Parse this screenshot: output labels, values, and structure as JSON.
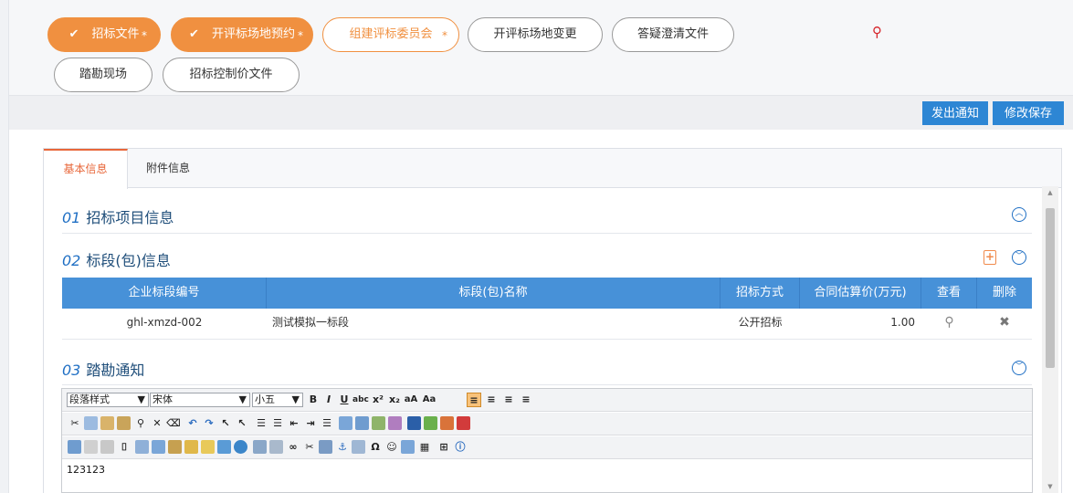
{
  "steps": [
    {
      "label": "招标文件",
      "state": "done",
      "check": "✔",
      "star": "*"
    },
    {
      "label": "开评标场地预约",
      "state": "done",
      "check": "✔",
      "star": "*"
    },
    {
      "label": "组建评标委员会",
      "state": "active",
      "check": "",
      "star": "*"
    },
    {
      "label": "开评标场地变更",
      "state": "pending",
      "check": "",
      "star": ""
    },
    {
      "label": "答疑澄清文件",
      "state": "pending",
      "check": "",
      "star": ""
    },
    {
      "label": "踏勘现场",
      "state": "pending",
      "check": "",
      "star": ""
    },
    {
      "label": "招标控制价文件",
      "state": "pending",
      "check": "",
      "star": ""
    }
  ],
  "pin_icon": "pin-icon",
  "toolbar": {
    "notify_label": "发出通知",
    "save_label": "修改保存"
  },
  "tabs": [
    {
      "label": "基本信息",
      "active": true
    },
    {
      "label": "附件信息",
      "active": false
    }
  ],
  "sections": {
    "s1": {
      "num": "01",
      "title": "招标项目信息"
    },
    "s2": {
      "num": "02",
      "title": "标段(包)信息"
    },
    "s3": {
      "num": "03",
      "title": "踏勘通知"
    }
  },
  "grid": {
    "headers": [
      "企业标段编号",
      "标段(包)名称",
      "招标方式",
      "合同估算价(万元)",
      "查看",
      "删除"
    ],
    "rows": [
      {
        "code": "ghl-xmzd-002",
        "name": "测试模拟一标段",
        "method": "公开招标",
        "price": "1.00",
        "view": "⚲",
        "delete": "✖"
      }
    ]
  },
  "editor": {
    "paragraph_style": "段落样式",
    "font_family": "宋体",
    "font_size": "小五",
    "content": "123123"
  },
  "colors": {
    "orange": "#f09040",
    "blue": "#4791d8",
    "link_blue": "#1f6fc4",
    "red": "#d6252b"
  }
}
